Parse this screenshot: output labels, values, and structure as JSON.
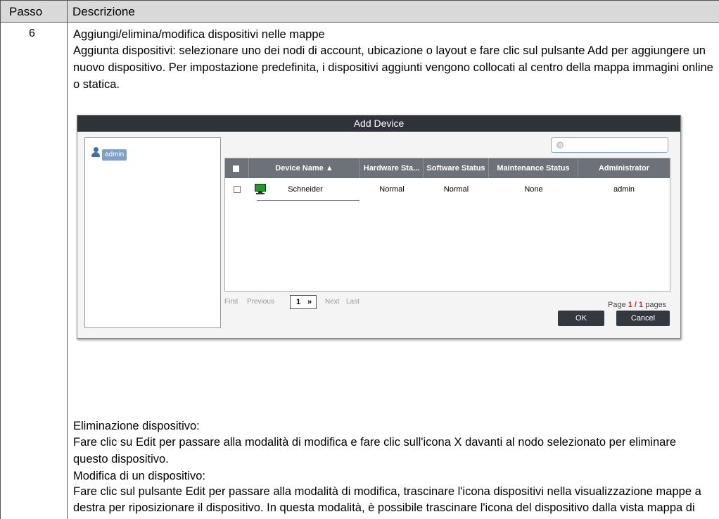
{
  "table": {
    "header_step": "Passo",
    "header_description": "Descrizione",
    "step_number": "6"
  },
  "intro": {
    "title": "Aggiungi/elimina/modifica dispositivi nelle mappe",
    "body_1": "Aggiunta dispositivi: selezionare uno dei nodi di account, ubicazione o layout e fare clic sul pulsante ",
    "body_add": "Add",
    "body_2": " per aggiungere un nuovo dispositivo. Per impostazione predefinita, i dispositivi aggiunti vengono collocati al centro della mappa immagini online o statica."
  },
  "dialog": {
    "title": "Add Device",
    "tree_node": "admin",
    "columns": [
      "Device Name ▲",
      "Hardware Sta...",
      "Software Status",
      "Maintenance Status",
      "Administrator"
    ],
    "row": {
      "device_name": "Schneider",
      "hardware_status": "Normal",
      "software_status": "Normal",
      "maintenance_status": "None",
      "administrator": "admin"
    },
    "pager": {
      "first": "First",
      "previous": "Previous",
      "page_value": "1",
      "next": "Next",
      "last": "Last",
      "page_label": "Page ",
      "page_current": "1 / 1",
      "page_suffix": " pages"
    },
    "ok_label": "OK",
    "cancel_label": "Cancel",
    "accent_color": "#e0222a",
    "titlebar_color": "#2f3338"
  },
  "delete_section": {
    "title": "Eliminazione dispositivo:",
    "body_1": "Fare clic su ",
    "edit": "Edit",
    "body_2": " per passare alla modalità di modifica e fare clic sull'icona ",
    "x": "X",
    "body_3": " davanti al nodo selezionato per eliminare questo dispositivo."
  },
  "modify_section": {
    "title": "Modifica di un dispositivo:",
    "body_1": "Fare clic sul pulsante ",
    "edit": "Edit",
    "body_2": " per passare alla modalità di modifica, trascinare l'icona dispositivi nella visualizzazione mappe a destra per riposizionare il dispositivo. In questa modalità, è possibile trascinare l'icona del dispositivo dalla vista mappa di destra sul nodo account o posizione o layout a sinistra per cambiare il livello di appartenenza."
  }
}
